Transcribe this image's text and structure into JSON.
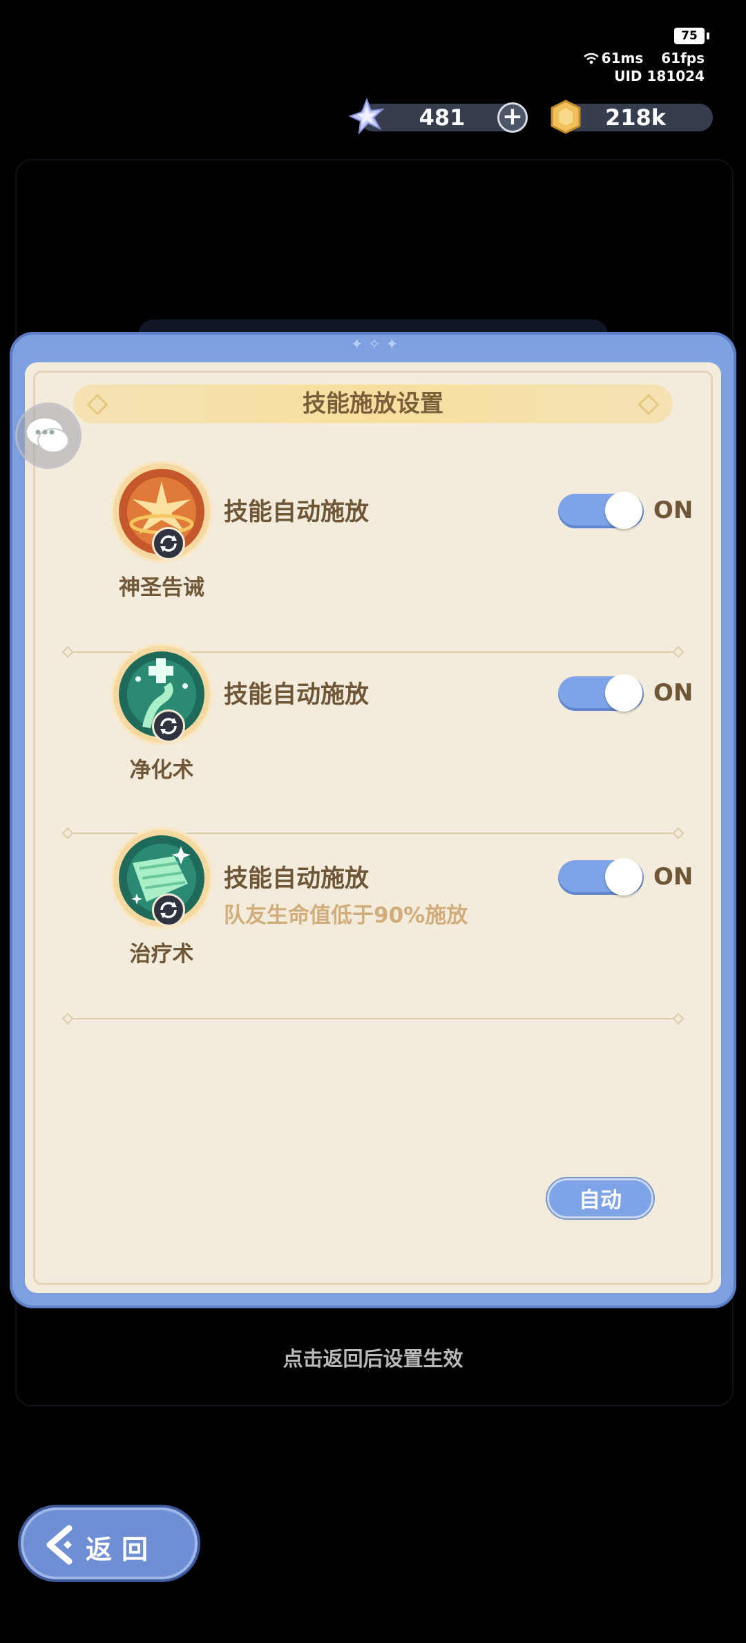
{
  "status": {
    "battery": "75",
    "ping": "61ms",
    "fps": "61fps",
    "uid": "UID 181024"
  },
  "currency": {
    "gems": "481",
    "gold": "218k"
  },
  "dialog": {
    "title": "技能施放设置",
    "skills": [
      {
        "name": "神圣告诫",
        "auto_label": "技能自动施放",
        "toggle": "ON",
        "condition": "",
        "icon": "holy-warning-icon",
        "icon_color": "#c4582b"
      },
      {
        "name": "净化术",
        "auto_label": "技能自动施放",
        "toggle": "ON",
        "condition": "",
        "icon": "purify-icon",
        "icon_color": "#1f6b5a"
      },
      {
        "name": "治疗术",
        "auto_label": "技能自动施放",
        "toggle": "ON",
        "condition": "队友生命值低于90%施放",
        "icon": "heal-icon",
        "icon_color": "#1f6b5a"
      }
    ],
    "auto_button": "自动"
  },
  "hint": "点击返回后设置生效",
  "back_button": "返回",
  "colors": {
    "dialog_frame": "#7da0e0",
    "dialog_bg": "#f3ebdb",
    "toggle_on": "#7ea3e6",
    "text": "#6e5636"
  }
}
